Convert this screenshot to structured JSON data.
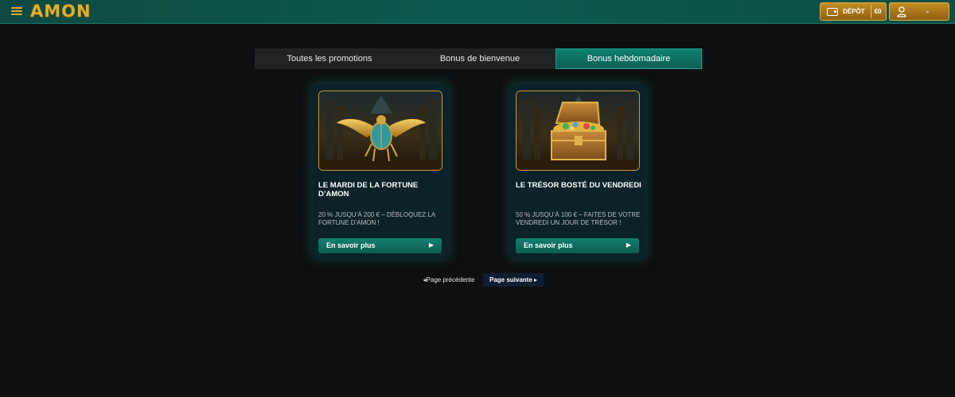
{
  "header": {
    "logo": "AMON",
    "deposit_label": "DÉPÔT",
    "balance": "€0"
  },
  "tabs": [
    {
      "label": "Toutes les promotions",
      "active": false
    },
    {
      "label": "Bonus de bienvenue",
      "active": false
    },
    {
      "label": "Bonus hebdomadaire",
      "active": true
    }
  ],
  "cards": [
    {
      "image": "scarab-icon",
      "title": "LE MARDI DE LA FORTUNE D’AMON",
      "description": "20 % JUSQU’À 200 € – DÉBLOQUEZ LA FORTUNE D’AMON !",
      "cta": "En savoir plus"
    },
    {
      "image": "treasure-chest-icon",
      "title": "LE TRÉSOR BOSTÉ DU VENDREDI",
      "description": "50 % JUSQU’À 100 € – FAITES DE VOTRE VENDREDI UN JOUR DE TRÉSOR !",
      "cta": "En savoir plus"
    }
  ],
  "pagination": {
    "prev": "◂Page précédente",
    "next": "Page suivante ▸"
  },
  "colors": {
    "accent_gold": "#d9a929",
    "header_teal": "#0b5a4f",
    "background": "#0d0f11",
    "card_bg": "#0b2328"
  }
}
